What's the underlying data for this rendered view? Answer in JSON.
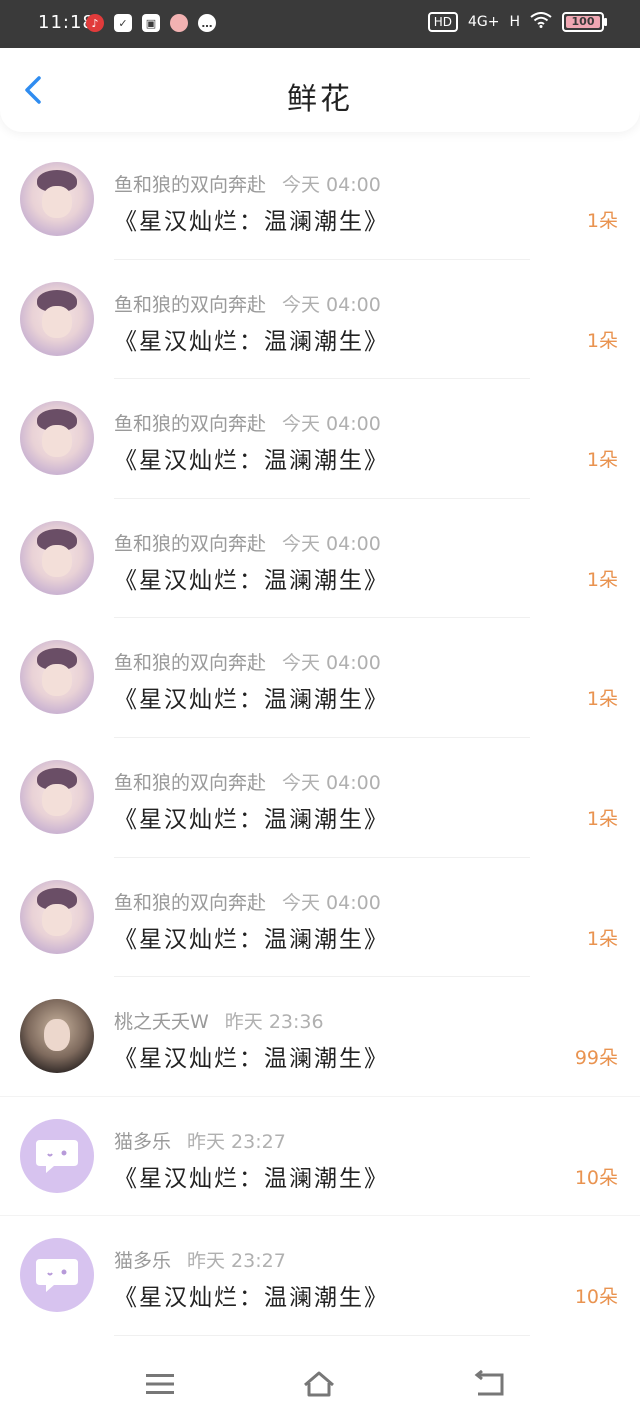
{
  "status_bar": {
    "time": "11:18",
    "hd": "HD",
    "signal1": "4G+",
    "signal2": "H",
    "battery": "100"
  },
  "header": {
    "title": "鲜花"
  },
  "colors": {
    "accent": "#2f8cf0",
    "count": "#e99350"
  },
  "items": [
    {
      "user": "鱼和狼的双向奔赴",
      "time": "今天 04:00",
      "title": "《星汉灿烂：温澜潮生》",
      "count": "1朵",
      "avatar": "baby"
    },
    {
      "user": "鱼和狼的双向奔赴",
      "time": "今天 04:00",
      "title": "《星汉灿烂：温澜潮生》",
      "count": "1朵",
      "avatar": "baby"
    },
    {
      "user": "鱼和狼的双向奔赴",
      "time": "今天 04:00",
      "title": "《星汉灿烂：温澜潮生》",
      "count": "1朵",
      "avatar": "baby"
    },
    {
      "user": "鱼和狼的双向奔赴",
      "time": "今天 04:00",
      "title": "《星汉灿烂：温澜潮生》",
      "count": "1朵",
      "avatar": "baby"
    },
    {
      "user": "鱼和狼的双向奔赴",
      "time": "今天 04:00",
      "title": "《星汉灿烂：温澜潮生》",
      "count": "1朵",
      "avatar": "baby"
    },
    {
      "user": "鱼和狼的双向奔赴",
      "time": "今天 04:00",
      "title": "《星汉灿烂：温澜潮生》",
      "count": "1朵",
      "avatar": "baby"
    },
    {
      "user": "鱼和狼的双向奔赴",
      "time": "今天 04:00",
      "title": "《星汉灿烂：温澜潮生》",
      "count": "1朵",
      "avatar": "baby"
    },
    {
      "user": "桃之夭夭W",
      "time": "昨天 23:36",
      "title": "《星汉灿烂：温澜潮生》",
      "count": "99朵",
      "avatar": "girl"
    },
    {
      "user": "猫多乐",
      "time": "昨天 23:27",
      "title": "《星汉灿烂：温澜潮生》",
      "count": "10朵",
      "avatar": "chat"
    },
    {
      "user": "猫多乐",
      "time": "昨天 23:27",
      "title": "《星汉灿烂：温澜潮生》",
      "count": "10朵",
      "avatar": "chat"
    }
  ],
  "nav": {
    "menu_icon": "menu-icon",
    "home_icon": "home-icon",
    "back_icon": "return-icon"
  }
}
